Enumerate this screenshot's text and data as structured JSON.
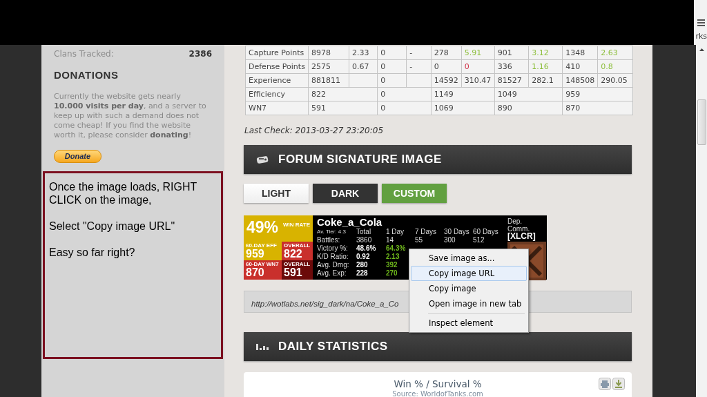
{
  "browser": {
    "bookmarks_text": "rks"
  },
  "sidebar": {
    "stats": [
      {
        "label": "Clans Tracked:",
        "value": "2386"
      }
    ],
    "donations": {
      "title": "DONATIONS",
      "text": "Currently the website gets nearly **10.000 visits per day**, and a server to keep up with such a demand does not come cheap! If you find the website worth it, please consider **donating**!",
      "button": "Donate"
    }
  },
  "annotation": {
    "paragraphs": [
      "Once the image loads, RIGHT CLICK on the image,",
      "Select \"Copy image URL\"",
      "Easy so far right?"
    ]
  },
  "stats_table": {
    "rows": [
      {
        "label": "Capture Points",
        "kind": "split",
        "cells": [
          {
            "text": "8978"
          },
          {
            "text": "2.33"
          },
          {
            "text": "0"
          },
          {
            "text": "-"
          },
          {
            "text": "278"
          },
          {
            "text": "5.91",
            "color": "#8dbf3c"
          },
          {
            "text": "901"
          },
          {
            "text": "3.12",
            "color": "#8dbf3c"
          },
          {
            "text": "1348"
          },
          {
            "text": "2.63",
            "color": "#8dbf3c"
          }
        ]
      },
      {
        "label": "Defense Points",
        "kind": "split",
        "cells": [
          {
            "text": "2575"
          },
          {
            "text": "0.67"
          },
          {
            "text": "0"
          },
          {
            "text": "-"
          },
          {
            "text": "0"
          },
          {
            "text": "0",
            "color": "#d0344a"
          },
          {
            "text": "336"
          },
          {
            "text": "1.16",
            "color": "#8dbf3c"
          },
          {
            "text": "410"
          },
          {
            "text": "0.8",
            "color": "#8dbf3c"
          }
        ]
      },
      {
        "label": "Experience",
        "kind": "split",
        "cells": [
          {
            "text": "881811"
          },
          {
            "text": ""
          },
          {
            "text": "0"
          },
          {
            "text": ""
          },
          {
            "text": "14592"
          },
          {
            "text": "310.47"
          },
          {
            "text": "81527"
          },
          {
            "text": "282.1"
          },
          {
            "text": "148508"
          },
          {
            "text": "290.05"
          }
        ]
      },
      {
        "label": "Efficiency",
        "kind": "merged",
        "cells": [
          {
            "text": "822",
            "colspan": 2
          },
          {
            "text": "0",
            "colspan": 2
          },
          {
            "text": "1149",
            "colspan": 2
          },
          {
            "text": "1049",
            "colspan": 2
          },
          {
            "text": "959",
            "colspan": 2
          }
        ]
      },
      {
        "label": "WN7",
        "kind": "merged",
        "cells": [
          {
            "text": "591",
            "colspan": 2
          },
          {
            "text": "0",
            "colspan": 2
          },
          {
            "text": "1069",
            "colspan": 2
          },
          {
            "text": "890",
            "colspan": 2
          },
          {
            "text": "870",
            "colspan": 2
          }
        ]
      }
    ]
  },
  "last_check": "Last Check: 2013-03-27 23:20:05",
  "signature": {
    "title": "FORUM SIGNATURE IMAGE",
    "styles": [
      {
        "label": "LIGHT",
        "kind": "light"
      },
      {
        "label": "DARK",
        "kind": "dark"
      },
      {
        "label": "CUSTOM",
        "kind": "custom"
      }
    ],
    "image": {
      "win_rate": "49%",
      "win_label": "WIN RATE",
      "eff_label": "60-DAY EFF",
      "eff": "959",
      "eff_overall_label": "OVERALL",
      "eff_overall": "822",
      "wn7_label": "60-DAY WN7",
      "wn7": "870",
      "wn7_overall_label": "OVERALL",
      "wn7_overall": "591",
      "player": "Coke_a_Cola",
      "tier": "Av. Tier: 4.3",
      "columns": [
        "Total",
        "1 Day",
        "7 Days",
        "30 Days",
        "60 Days"
      ],
      "rows": [
        {
          "label": "Battles:",
          "values": [
            {
              "text": "3860"
            },
            {
              "text": "14"
            },
            {
              "text": "55"
            },
            {
              "text": "300"
            },
            {
              "text": "512"
            }
          ]
        },
        {
          "label": "Victory %:",
          "values": [
            {
              "text": "48.6%",
              "color": "#ffffff"
            },
            {
              "text": "64.3%",
              "color": "#6fb81c"
            }
          ]
        },
        {
          "label": "K/D Ratio:",
          "values": [
            {
              "text": "0.92",
              "color": "#ffffff"
            },
            {
              "text": "2.13",
              "color": "#6fb81c"
            }
          ]
        },
        {
          "label": "Avg. Dmg:",
          "values": [
            {
              "text": "280",
              "color": "#ffffff"
            },
            {
              "text": "392",
              "color": "#6fb81c"
            }
          ]
        },
        {
          "label": "Avg. Exp:",
          "values": [
            {
              "text": "228",
              "color": "#ffffff"
            },
            {
              "text": "270",
              "color": "#6fb81c"
            }
          ]
        }
      ],
      "clan_rank": "Dep. Comm.",
      "clan_tag": "[XLCR]"
    },
    "url": "http://wotlabs.net/sig_dark/na/Coke_a_Co"
  },
  "context_menu": {
    "items": [
      {
        "label": "Save image as...",
        "selected": false,
        "separated": false
      },
      {
        "label": "Copy image URL",
        "selected": true,
        "separated": false
      },
      {
        "label": "Copy image",
        "selected": false,
        "separated": false
      },
      {
        "label": "Open image in new tab",
        "selected": false,
        "separated": false
      },
      {
        "label": "Inspect element",
        "selected": false,
        "separated": true
      }
    ]
  },
  "daily": {
    "title": "DAILY STATISTICS",
    "chart_title": "Win % / Survival %",
    "chart_subtitle": "Source: WorldofTanks.com"
  }
}
